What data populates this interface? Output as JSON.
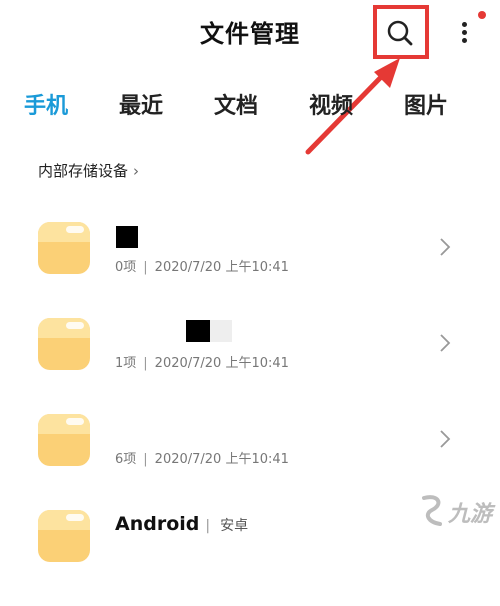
{
  "header": {
    "title": "文件管理",
    "search_icon": "search-icon",
    "more_icon": "more-vertical-icon",
    "accent_dot_color": "#e53935"
  },
  "annotation": {
    "highlight_color": "#e53935"
  },
  "tabs": [
    {
      "label": "手机",
      "active": true
    },
    {
      "label": "最近",
      "active": false
    },
    {
      "label": "文档",
      "active": false
    },
    {
      "label": "视频",
      "active": false
    },
    {
      "label": "图片",
      "active": false
    }
  ],
  "colors": {
    "accent": "#1a9ad8",
    "folder": "#fbd076"
  },
  "breadcrumb": {
    "label": "内部存储设备",
    "chevron": "›"
  },
  "files": [
    {
      "name": "",
      "count": "0项",
      "date": "2020/7/20 上午10:41",
      "separator": "|"
    },
    {
      "name": "",
      "count": "1项",
      "date": "2020/7/20 上午10:41",
      "separator": "|"
    },
    {
      "name": "",
      "count": "6项",
      "date": "2020/7/20 上午10:41",
      "separator": "|"
    },
    {
      "name": "Android",
      "tag": "安卓"
    }
  ],
  "watermark": {
    "text": "九游"
  }
}
